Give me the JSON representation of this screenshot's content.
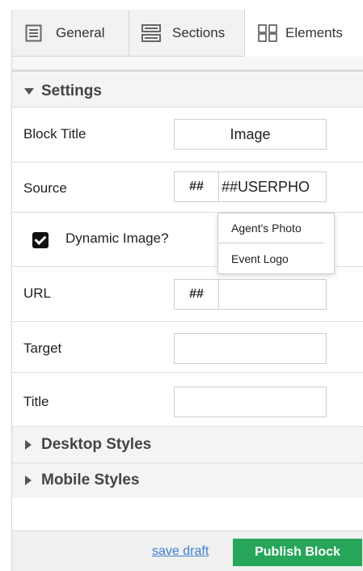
{
  "tabs": {
    "general": "General",
    "sections": "Sections",
    "elements": "Elements"
  },
  "settings": {
    "header": "Settings",
    "block_title_label": "Block Title",
    "block_title_value": "Image",
    "source_label": "Source",
    "source_hash": "##",
    "source_value": "##USERPHO",
    "source_options": [
      "Agent's Photo",
      "Event Logo"
    ],
    "dynamic_label": "Dynamic Image?",
    "dynamic_checked": true,
    "url_label": "URL",
    "url_hash": "##",
    "url_value": "",
    "target_label": "Target",
    "target_value": "",
    "title_label": "Title",
    "title_value": ""
  },
  "desktop_styles": "Desktop Styles",
  "mobile_styles": "Mobile Styles",
  "footer": {
    "save_draft": "save draft",
    "publish": "Publish Block"
  },
  "colors": {
    "publish_bg": "#27a65a",
    "link": "#3a7fd0"
  },
  "icons": [
    "general-icon",
    "sections-icon",
    "elements-grid-icon",
    "caret-down-icon",
    "caret-right-icon",
    "checkbox-checked-icon"
  ]
}
